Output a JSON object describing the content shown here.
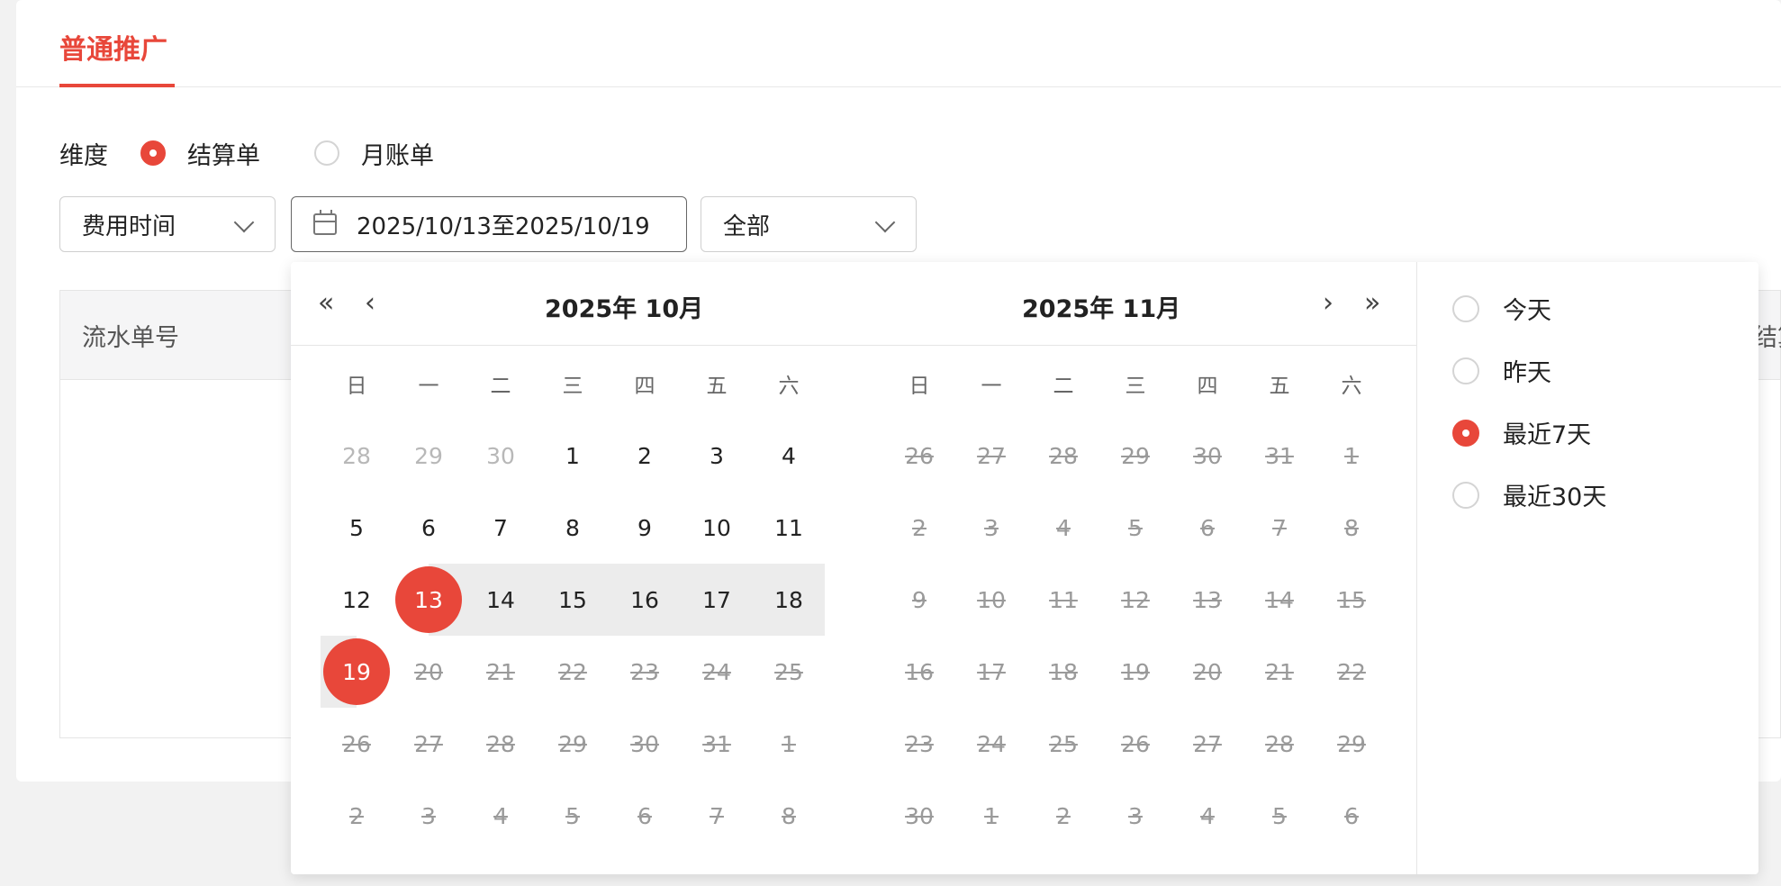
{
  "tab": {
    "label": "普通推广"
  },
  "dimension": {
    "label": "维度",
    "options": [
      {
        "label": "结算单",
        "checked": true
      },
      {
        "label": "月账单",
        "checked": false
      }
    ]
  },
  "filters": {
    "time_type": "费用时间",
    "date_range": "2025/10/13至2025/10/19",
    "scope": "全部"
  },
  "table": {
    "columns": [
      "流水单号",
      "结算类"
    ]
  },
  "calendar": {
    "weekdays": [
      "日",
      "一",
      "二",
      "三",
      "四",
      "五",
      "六"
    ],
    "left": {
      "title": "2025年 10月",
      "weeks": [
        [
          "28",
          "29",
          "30",
          "1",
          "2",
          "3",
          "4"
        ],
        [
          "5",
          "6",
          "7",
          "8",
          "9",
          "10",
          "11"
        ],
        [
          "12",
          "13",
          "14",
          "15",
          "16",
          "17",
          "18"
        ],
        [
          "19",
          "20",
          "21",
          "22",
          "23",
          "24",
          "25"
        ],
        [
          "26",
          "27",
          "28",
          "29",
          "30",
          "31",
          "1"
        ],
        [
          "2",
          "3",
          "4",
          "5",
          "6",
          "7",
          "8"
        ]
      ]
    },
    "right": {
      "title": "2025年 11月",
      "weeks": [
        [
          "26",
          "27",
          "28",
          "29",
          "30",
          "31",
          "1"
        ],
        [
          "2",
          "3",
          "4",
          "5",
          "6",
          "7",
          "8"
        ],
        [
          "9",
          "10",
          "11",
          "12",
          "13",
          "14",
          "15"
        ],
        [
          "16",
          "17",
          "18",
          "19",
          "20",
          "21",
          "22"
        ],
        [
          "23",
          "24",
          "25",
          "26",
          "27",
          "28",
          "29"
        ],
        [
          "30",
          "1",
          "2",
          "3",
          "4",
          "5",
          "6"
        ]
      ]
    },
    "nav": {
      "prev_year": "«",
      "prev_month": "‹",
      "next_month": "›",
      "next_year": "»"
    }
  },
  "quick_ranges": [
    {
      "label": "今天",
      "checked": false
    },
    {
      "label": "昨天",
      "checked": false
    },
    {
      "label": "最近7天",
      "checked": true
    },
    {
      "label": "最近30天",
      "checked": false
    }
  ],
  "colors": {
    "accent": "#e8473a"
  }
}
